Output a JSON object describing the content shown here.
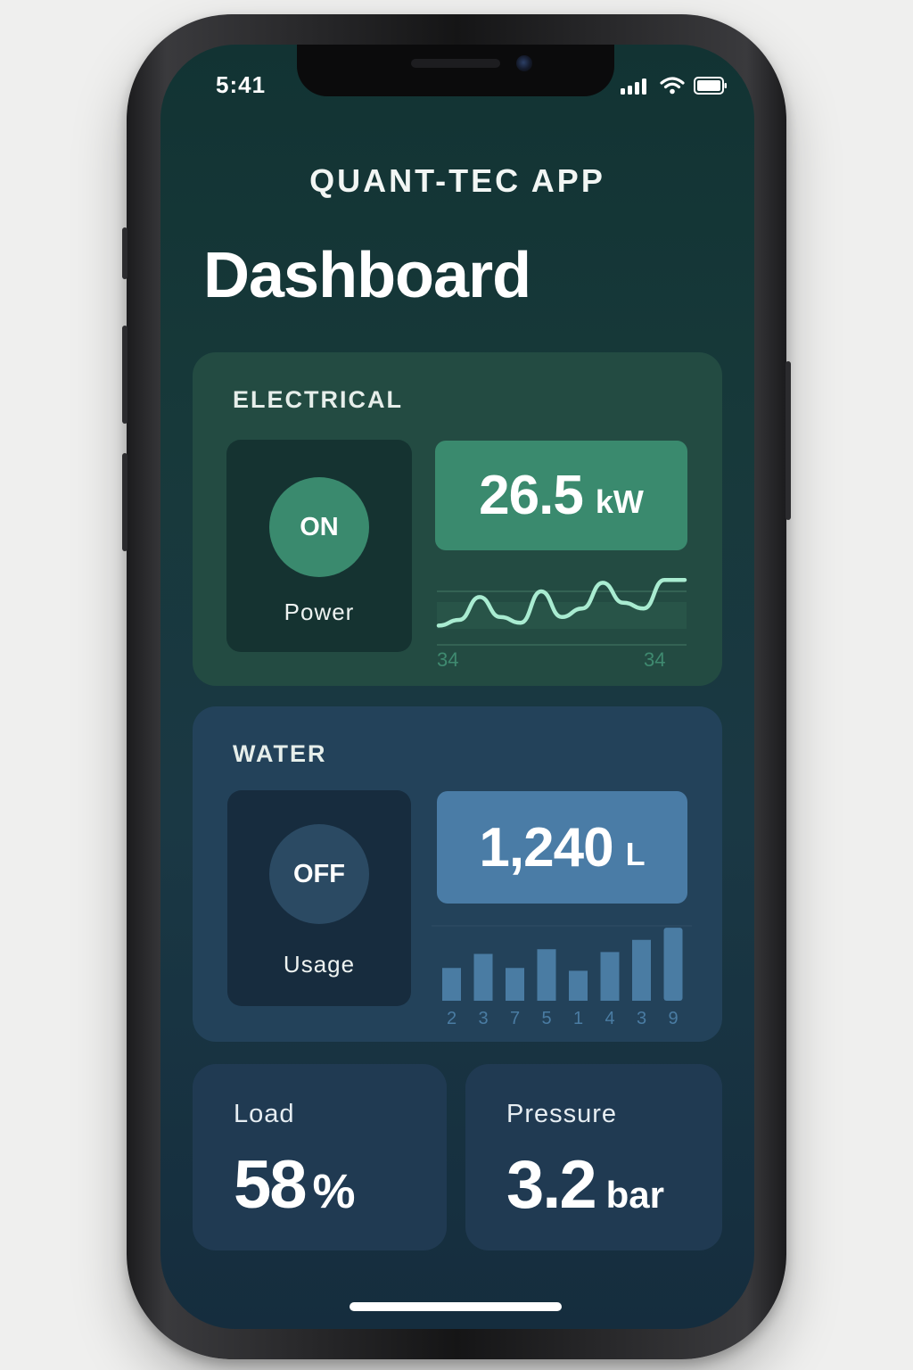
{
  "status_bar": {
    "time": "5:41",
    "icons": [
      "signal-icon",
      "wifi-icon",
      "battery-icon"
    ]
  },
  "header": {
    "app_title": "QUANT-TEC APP",
    "page_title": "Dashboard"
  },
  "electrical": {
    "label": "ELECTRICAL",
    "toggle_state": "ON",
    "toggle_caption": "Power",
    "value": "26.5",
    "unit": "kW",
    "sparkline_left_label": "34",
    "sparkline_right_label": "34"
  },
  "water": {
    "label": "WATER",
    "toggle_state": "OFF",
    "toggle_caption": "Usage",
    "value": "1,240",
    "unit": "L"
  },
  "load": {
    "label": "Load",
    "value": "58",
    "unit": "%"
  },
  "pressure": {
    "label": "Pressure",
    "value": "3.2",
    "unit": "bar"
  },
  "chart_data": [
    {
      "type": "line",
      "y_relative": [
        0.15,
        0.25,
        0.65,
        0.3,
        0.2,
        0.75,
        0.3,
        0.45,
        0.9,
        0.55,
        0.45,
        0.95,
        0.95
      ],
      "x_tick_labels": [
        "34",
        "34"
      ]
    },
    {
      "type": "bar",
      "categories": [
        "2",
        "3",
        "7",
        "5",
        "1",
        "4",
        "3",
        "9"
      ],
      "values": [
        3.5,
        5,
        3.5,
        5.5,
        3.2,
        5.2,
        6.5,
        7.8
      ],
      "ylim": [
        0,
        8
      ]
    }
  ],
  "colors": {
    "electrical_accent": "#3a8a6e",
    "water_accent": "#4a7ca6",
    "sparkline": "#a9ecd1",
    "bar": "#4a7ca3"
  }
}
